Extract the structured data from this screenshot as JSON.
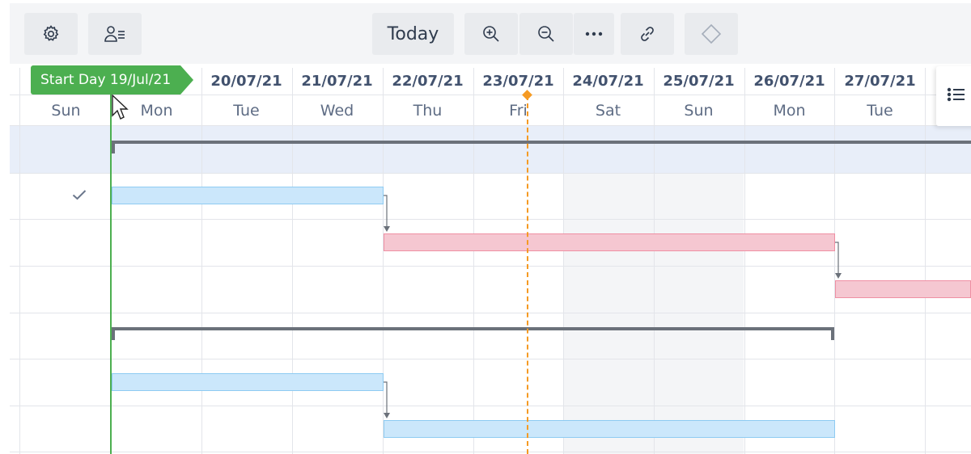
{
  "toolbar": {
    "settings_icon": "gear-icon",
    "people_icon": "people-list-icon",
    "today_label": "Today",
    "zoom_in_icon": "zoom-in-icon",
    "zoom_out_icon": "zoom-out-icon",
    "more_icon": "more-icon",
    "link_icon": "link-icon",
    "milestone_icon": "diamond-icon"
  },
  "timeline": {
    "start_flag": "Start Day 19/Jul/21",
    "dates": [
      "20/07/21",
      "21/07/21",
      "22/07/21",
      "23/07/21",
      "24/07/21",
      "25/07/21",
      "26/07/21",
      "27/07/21"
    ],
    "days": [
      "Sun",
      "Mon",
      "Tue",
      "Wed",
      "Thu",
      "Fri",
      "Sat",
      "Sun",
      "Mon",
      "Tue"
    ],
    "weekend_days": [
      "Sat",
      "Sun"
    ],
    "today": "Fri 23/07/21"
  },
  "tasks": [
    {
      "type": "group",
      "start": "Mon 19/07/21",
      "end": "beyond view",
      "row": 1
    },
    {
      "type": "task",
      "color": "blue",
      "start": "Mon 19/07/21",
      "end": "Wed 21/07/21",
      "row": 2,
      "done": true
    },
    {
      "type": "task",
      "color": "red",
      "start": "Thu 22/07/21",
      "end": "Mon 26/07/21",
      "row": 3
    },
    {
      "type": "task",
      "color": "red",
      "start": "Tue 27/07/21",
      "end": "beyond view",
      "row": 4
    },
    {
      "type": "group",
      "start": "Mon 19/07/21",
      "end": "Mon 26/07/21",
      "row": 5
    },
    {
      "type": "task",
      "color": "blue",
      "start": "Mon 19/07/21",
      "end": "Wed 21/07/21",
      "row": 6
    },
    {
      "type": "task",
      "color": "blue",
      "start": "Thu 22/07/21",
      "end": "Mon 26/07/21",
      "row": 7
    }
  ],
  "colors": {
    "start_line": "#4caf50",
    "today_line": "#f59a23",
    "task_blue": "#cbe7fb",
    "task_red": "#f5c7d1",
    "group_bar": "#6b717a"
  },
  "list_icon": "list-icon",
  "check_icon": "check-icon"
}
